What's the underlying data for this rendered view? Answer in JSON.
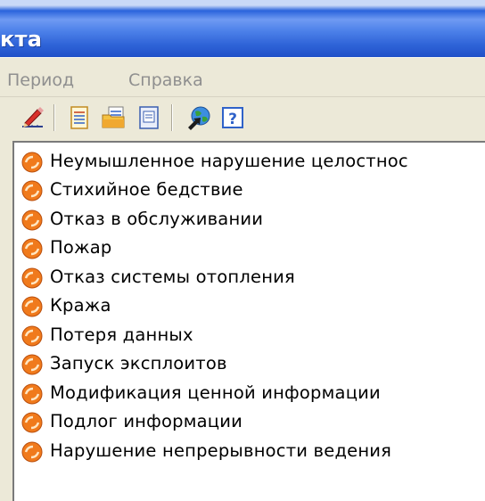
{
  "window": {
    "title_fragment": "кта"
  },
  "menubar": {
    "items": [
      "Период",
      "Справка"
    ]
  },
  "toolbar": {
    "buttons": [
      {
        "icon": "pencil-ruler-icon"
      },
      {
        "icon": "document-list-icon"
      },
      {
        "icon": "folder-document-icon"
      },
      {
        "icon": "document-card-icon"
      },
      {
        "icon": "globe-arrow-icon"
      },
      {
        "icon": "help-icon"
      }
    ]
  },
  "threats": {
    "icon": "orange-threat-icon",
    "items": [
      "Неумышленное нарушение целостнос",
      "Стихийное бедствие",
      "Отказ в обслуживании",
      "Пожар",
      "Отказ системы отопления",
      "Кража",
      "Потеря данных",
      "Запуск эксплоитов",
      "Модификация ценной информации",
      "Подлог информации",
      "Нарушение непрерывности ведения"
    ]
  },
  "colors": {
    "title_bar": "#2f64d8",
    "menu_background": "#ece9d8",
    "menu_text_disabled": "#8f8f8f",
    "threat_icon": "#f07a1c"
  }
}
